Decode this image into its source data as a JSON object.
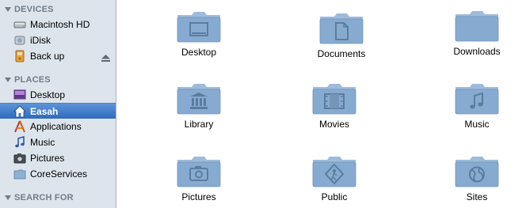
{
  "sidebar": {
    "devices_header": "DEVICES",
    "places_header": "PLACES",
    "search_header": "SEARCH FOR",
    "devices": [
      {
        "label": "Macintosh HD",
        "icon": "hard-drive-icon"
      },
      {
        "label": "iDisk",
        "icon": "idisk-icon"
      },
      {
        "label": "Back up",
        "icon": "backup-drive-icon",
        "eject": true
      }
    ],
    "places": [
      {
        "label": "Desktop",
        "icon": "desktop-icon"
      },
      {
        "label": "Easah",
        "icon": "home-icon",
        "selected": true
      },
      {
        "label": "Applications",
        "icon": "applications-icon"
      },
      {
        "label": "Music",
        "icon": "music-note-icon"
      },
      {
        "label": "Pictures",
        "icon": "camera-icon"
      },
      {
        "label": "CoreServices",
        "icon": "folder-icon"
      }
    ]
  },
  "folders": [
    {
      "label": "Desktop",
      "glyph": "desktop"
    },
    {
      "label": "Documents",
      "glyph": "document"
    },
    {
      "label": "Downloads",
      "glyph": "none"
    },
    {
      "label": "Library",
      "glyph": "library"
    },
    {
      "label": "Movies",
      "glyph": "film"
    },
    {
      "label": "Music",
      "glyph": "note"
    },
    {
      "label": "Pictures",
      "glyph": "camera"
    },
    {
      "label": "Public",
      "glyph": "public"
    },
    {
      "label": "Sites",
      "glyph": "globe"
    }
  ],
  "colors": {
    "sidebar_bg": "#dde4ec",
    "selection": "#3f7cca",
    "folder_body": "#87abd0",
    "folder_tab": "#9dbbda",
    "glyph": "#5c7c9e"
  }
}
